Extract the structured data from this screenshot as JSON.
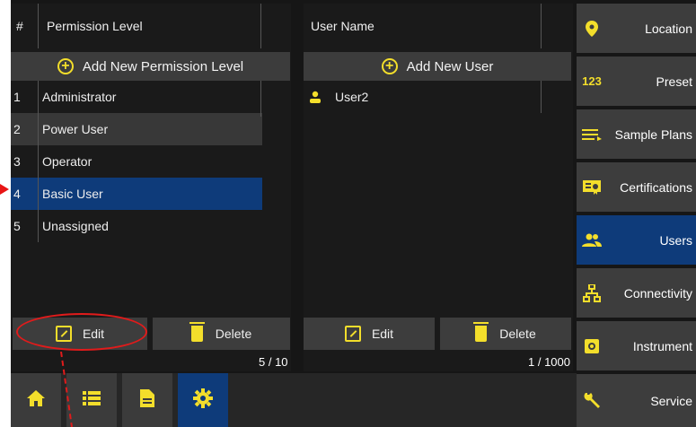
{
  "permissions": {
    "col_hash": "#",
    "col_title": "Permission Level",
    "add_label": "Add New Permission Level",
    "rows": [
      {
        "num": "1",
        "label": "Administrator"
      },
      {
        "num": "2",
        "label": "Power User"
      },
      {
        "num": "3",
        "label": "Operator"
      },
      {
        "num": "4",
        "label": "Basic User"
      },
      {
        "num": "5",
        "label": "Unassigned"
      }
    ],
    "selected_index": 3,
    "edit_label": "Edit",
    "delete_label": "Delete",
    "count": "5 / 10"
  },
  "users": {
    "col_title": "User Name",
    "add_label": "Add New User",
    "rows": [
      {
        "label": "User2"
      }
    ],
    "edit_label": "Edit",
    "delete_label": "Delete",
    "count": "1 / 1000"
  },
  "sidebar": {
    "items": [
      {
        "icon": "location-pin-icon",
        "icon_text": "",
        "label": "Location"
      },
      {
        "icon": "preset-123-icon",
        "icon_text": "123",
        "label": "Preset"
      },
      {
        "icon": "sample-plans-icon",
        "icon_text": "",
        "label": "Sample Plans"
      },
      {
        "icon": "certificate-icon",
        "icon_text": "",
        "label": "Certifications"
      },
      {
        "icon": "users-icon",
        "icon_text": "",
        "label": "Users"
      },
      {
        "icon": "network-icon",
        "icon_text": "",
        "label": "Connectivity"
      },
      {
        "icon": "instrument-icon",
        "icon_text": "",
        "label": "Instrument"
      },
      {
        "icon": "wrench-icon",
        "icon_text": "",
        "label": "Service"
      }
    ],
    "active": "Users"
  },
  "bottom_nav": {
    "items": [
      "home-icon",
      "list-icon",
      "document-icon",
      "gear-icon"
    ],
    "active": "gear-icon"
  },
  "colors": {
    "accent_yellow": "#f3de2b",
    "selected_blue": "#0e3b7a",
    "annotation_red": "#e01b1b"
  }
}
